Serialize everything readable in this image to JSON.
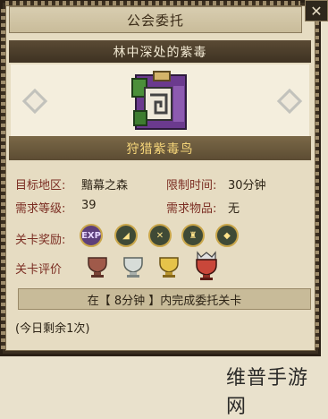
{
  "header": {
    "title": "公会委托"
  },
  "quest": {
    "name": "林中深处的紫毒",
    "target": "狩猎紫毒鸟"
  },
  "info": {
    "area_label": "目标地区:",
    "area_value": "黯幕之森",
    "time_label": "限制时间:",
    "time_value": "30分钟",
    "level_label": "需求等级:",
    "level_value": "39",
    "item_label": "需求物品:",
    "item_value": "无"
  },
  "rewards": {
    "label": "关卡奖励:",
    "items": [
      {
        "icon": "exp-icon",
        "text": "EXP"
      },
      {
        "icon": "material-icon"
      },
      {
        "icon": "crossed-swords-icon"
      },
      {
        "icon": "armor-icon"
      },
      {
        "icon": "gem-icon"
      }
    ]
  },
  "evaluation": {
    "label": "关卡评价",
    "cups": [
      "bronze-cup-icon",
      "silver-cup-icon",
      "gold-cup-icon",
      "crowned-cup-icon"
    ]
  },
  "condition": "在【 8分钟 】内完成委托关卡",
  "daily": "(今日剩余1次)",
  "watermark": "维普手游网",
  "colors": {
    "label_red": "#7b2d22",
    "band_dark": "#3e3222",
    "target_gold": "#f6d67a",
    "paper": "#e6dcc2"
  }
}
